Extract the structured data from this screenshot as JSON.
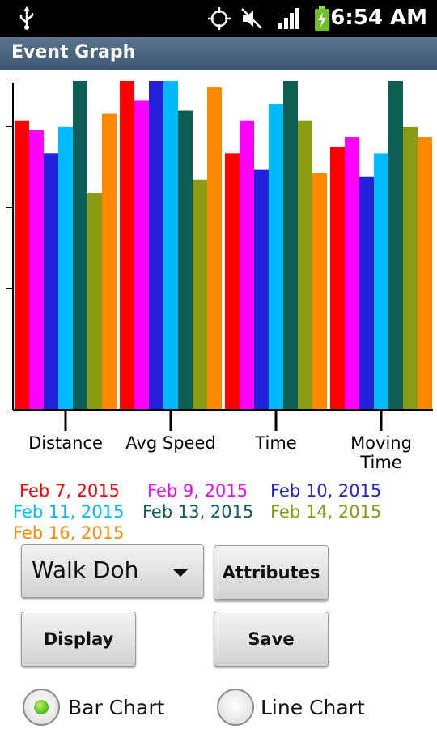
{
  "status_bar": {
    "time": "6:54 AM",
    "icons": [
      "usb-icon",
      "gps-icon",
      "muted-icon",
      "signal-icon",
      "battery-charging-icon"
    ]
  },
  "title_bar": {
    "title": "Event Graph"
  },
  "chart_data": {
    "type": "bar",
    "categories": [
      "Distance",
      "Avg Speed",
      "Time",
      "Moving Time"
    ],
    "ylim": [
      0,
      1
    ],
    "grid": false,
    "legend_position": "bottom",
    "series": [
      {
        "name": "Feb 7, 2015",
        "color": "#ff0000",
        "values": [
          0.88,
          1.0,
          0.78,
          0.8
        ]
      },
      {
        "name": "Feb 9, 2015",
        "color": "#ff00ff",
        "values": [
          0.85,
          0.94,
          0.88,
          0.83
        ]
      },
      {
        "name": "Feb 10, 2015",
        "color": "#2222dd",
        "values": [
          0.78,
          1.0,
          0.73,
          0.71
        ]
      },
      {
        "name": "Feb 11, 2015",
        "color": "#00baff",
        "values": [
          0.86,
          1.0,
          0.93,
          0.78
        ]
      },
      {
        "name": "Feb 13, 2015",
        "color": "#0d5e55",
        "values": [
          1.0,
          0.91,
          1.0,
          1.0
        ]
      },
      {
        "name": "Feb 14, 2015",
        "color": "#8a9a13",
        "values": [
          0.66,
          0.7,
          0.88,
          0.86
        ]
      },
      {
        "name": "Feb 16, 2015",
        "color": "#ff8800",
        "values": [
          0.9,
          0.98,
          0.72,
          0.83
        ]
      }
    ]
  },
  "controls": {
    "event_dropdown_value": "Walk Doh",
    "attributes_label": "Attributes",
    "display_label": "Display",
    "save_label": "Save",
    "bar_chart_label": "Bar Chart",
    "line_chart_label": "Line Chart",
    "selected_chart": "Bar Chart"
  }
}
